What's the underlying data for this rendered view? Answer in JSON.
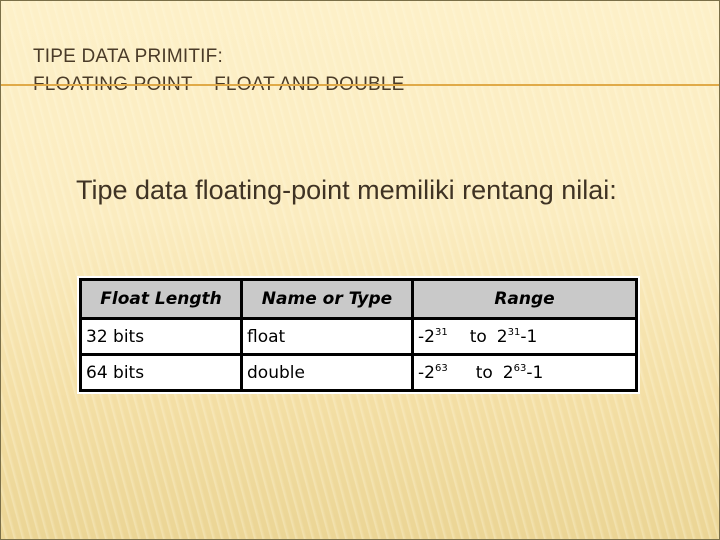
{
  "slide": {
    "title_line1": "TIPE DATA PRIMITIF:",
    "title_line2": "FLOATING POINT – FLOAT AND DOUBLE",
    "subtitle": "Tipe data floating-point memiliki rentang nilai:",
    "colors": {
      "title_text": "#4a3b28",
      "accent_rule": "#e0aa48",
      "background": "#fbecc0",
      "table_header_bg": "#c9c9c9"
    }
  },
  "table": {
    "headers": [
      "Float Length",
      "Name or Type",
      "Range"
    ],
    "rows": [
      {
        "length": "32 bits",
        "type": "float",
        "range_min_base": "-2",
        "range_min_exp": "31",
        "range_to": "to",
        "range_max_base": "2",
        "range_max_exp": "31",
        "range_max_suffix": "-1"
      },
      {
        "length": "64 bits",
        "type": "double",
        "range_min_base": "-2",
        "range_min_exp": "63",
        "range_to": "to",
        "range_max_base": "2",
        "range_max_exp": "63",
        "range_max_suffix": "-1"
      }
    ]
  }
}
